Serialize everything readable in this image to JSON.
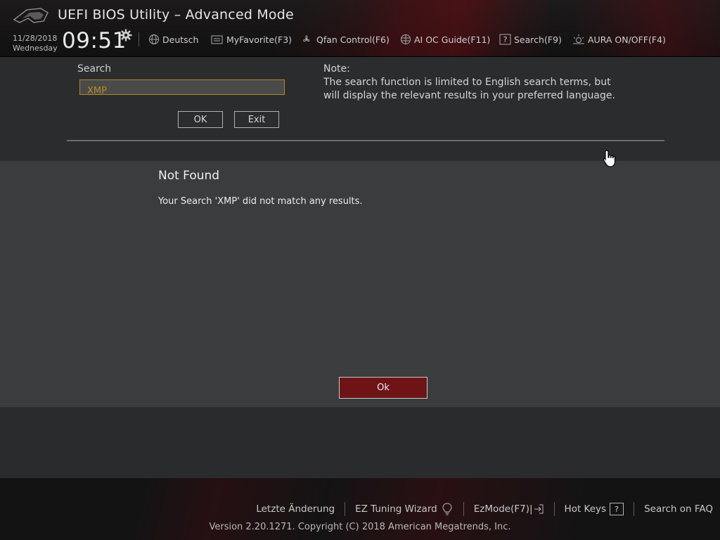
{
  "header": {
    "app_title": "UEFI BIOS Utility – Advanced Mode",
    "date": "11/28/2018",
    "day": "Wednesday",
    "time": "09:51",
    "menu": [
      {
        "label": "Deutsch",
        "icon": "globe-icon"
      },
      {
        "label": "MyFavorite(F3)",
        "icon": "favorite-icon"
      },
      {
        "label": "Qfan Control(F6)",
        "icon": "fan-icon"
      },
      {
        "label": "AI OC Guide(F11)",
        "icon": "ai-globe-icon"
      },
      {
        "label": "Search(F9)",
        "icon": "help-box-icon"
      },
      {
        "label": "AURA ON/OFF(F4)",
        "icon": "aura-icon"
      }
    ]
  },
  "search": {
    "label": "Search",
    "value": "XMP",
    "ok_label": "OK",
    "exit_label": "Exit",
    "note_title": "Note:",
    "note_text": "The search function is limited to English search terms, but will display the relevant results in your preferred language."
  },
  "dialog": {
    "title": "Not Found",
    "message": "Your Search 'XMP' did not match any results.",
    "ok_label": "Ok"
  },
  "footer": {
    "links": [
      {
        "label": "Letzte Änderung"
      },
      {
        "label": "EZ Tuning Wizard",
        "icon": "bulb-icon"
      },
      {
        "label": "EzMode(F7)|",
        "icon": "exit-arrow-icon"
      },
      {
        "label": "Hot Keys",
        "icon": "question-box-icon"
      },
      {
        "label": "Search on FAQ"
      }
    ],
    "copyright": "Version 2.20.1271. Copyright (C) 2018 American Megatrends, Inc."
  },
  "colors": {
    "accent_red": "#6e1416",
    "input_border": "#a8892e",
    "input_text": "#b88d26"
  }
}
